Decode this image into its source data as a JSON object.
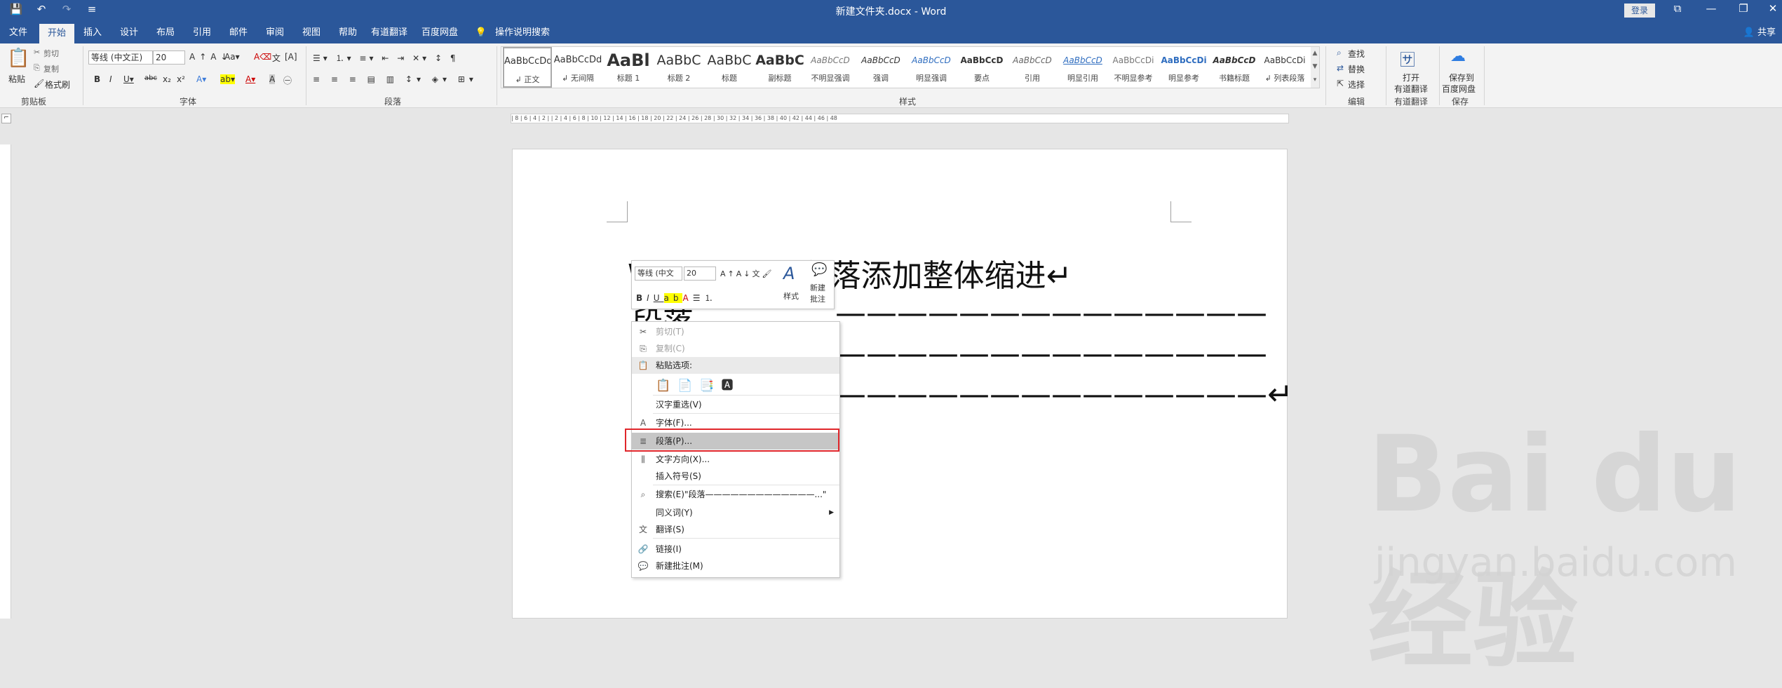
{
  "title_bar": {
    "document_title": "新建文件夹.docx - Word",
    "login_label": "登录",
    "qat": [
      "💾",
      "↶",
      "↷",
      "≡"
    ],
    "win_controls": [
      "⧉",
      "—",
      "❐",
      "✕"
    ]
  },
  "tabs": [
    "文件",
    "开始",
    "插入",
    "设计",
    "布局",
    "引用",
    "邮件",
    "审阅",
    "视图",
    "帮助",
    "有道翻译",
    "百度网盘"
  ],
  "tell_me": "操作说明搜索",
  "share_label": "共享",
  "ribbon": {
    "clipboard": {
      "paste": "粘贴",
      "cut": "剪切",
      "copy": "复制",
      "format_painter": "格式刷",
      "label": "剪贴板"
    },
    "font": {
      "name": "等线 (中文正)",
      "size": "20",
      "label": "字体"
    },
    "paragraph": {
      "label": "段落"
    },
    "styles": {
      "label": "样式",
      "items": [
        {
          "preview": "AaBbCcDd",
          "name": "↲ 正文"
        },
        {
          "preview": "AaBbCcDd",
          "name": "↲ 无间隔"
        },
        {
          "preview": "AaBl",
          "name": "标题 1"
        },
        {
          "preview": "AaBbC",
          "name": "标题 2"
        },
        {
          "preview": "AaBbC",
          "name": "标题"
        },
        {
          "preview": "AaBbC",
          "name": "副标题"
        },
        {
          "preview": "AaBbCcD",
          "name": "不明显强调"
        },
        {
          "preview": "AaBbCcD",
          "name": "强调"
        },
        {
          "preview": "AaBbCcD",
          "name": "明显强调"
        },
        {
          "preview": "AaBbCcD",
          "name": "要点"
        },
        {
          "preview": "AaBbCcD",
          "name": "引用"
        },
        {
          "preview": "AaBbCcD",
          "name": "明显引用"
        },
        {
          "preview": "AaBbCcDi",
          "name": "不明显参考"
        },
        {
          "preview": "AaBbCcDi",
          "name": "明显参考"
        },
        {
          "preview": "AaBbCcD",
          "name": "书籍标题"
        },
        {
          "preview": "AaBbCcDi",
          "name": "↲ 列表段落"
        }
      ]
    },
    "editing": {
      "find": "查找",
      "replace": "替换",
      "select": "选择",
      "label": "编辑"
    },
    "youdao": {
      "open_line1": "打开",
      "open_line2": "有道翻译",
      "label": "有道翻译"
    },
    "baidu": {
      "save_line1": "保存到",
      "save_line2": "百度网盘",
      "label": "保存"
    }
  },
  "ruler_text": "| 8 | 6 | 4 | 2 |  | 2 | 4 | 6 | 8 | 10 | 12 | 14 | 16 | 18 | 20 | 22 | 24 | 26 | 28 | 30 | 32 | 34 | 36 | 38 | 40 | 42 | 44 | 46 | 48",
  "document": {
    "line1": "WORD 中给段落添加整体缩进↵",
    "line2_prefix": "段落",
    "dashes": "——————————————",
    "line4_end": "——————————————↵"
  },
  "mini_toolbar": {
    "font": "等线 (中文",
    "size": "20",
    "styles_label": "样式",
    "new_comment_line1": "新建",
    "new_comment_line2": "批注"
  },
  "context_menu": {
    "items": [
      {
        "icon": "✂",
        "label": "剪切(T)",
        "disabled": true
      },
      {
        "icon": "⎘",
        "label": "复制(C)",
        "disabled": true
      },
      {
        "icon": "📋",
        "label": "粘贴选项:",
        "disabled": false
      },
      {
        "icon": "",
        "label": "汉字重选(V)",
        "disabled": false
      },
      {
        "icon": "A",
        "label": "字体(F)...",
        "disabled": false
      },
      {
        "icon": "≣",
        "label": "段落(P)...",
        "disabled": false
      },
      {
        "icon": "⫼",
        "label": "文字方向(X)...",
        "disabled": false
      },
      {
        "icon": "",
        "label": "插入符号(S)",
        "disabled": false
      },
      {
        "icon": "⌕",
        "label": "搜索(E)\"段落—————————————...\"",
        "disabled": false
      },
      {
        "icon": "",
        "label": "同义词(Y)",
        "disabled": false
      },
      {
        "icon": "文",
        "label": "翻译(S)",
        "disabled": false
      },
      {
        "icon": "🔗",
        "label": "链接(I)",
        "disabled": false
      },
      {
        "icon": "💬",
        "label": "新建批注(M)",
        "disabled": false
      }
    ]
  },
  "watermark": {
    "brand": "Bai du 经验",
    "url": "jingyan.baidu.com"
  }
}
